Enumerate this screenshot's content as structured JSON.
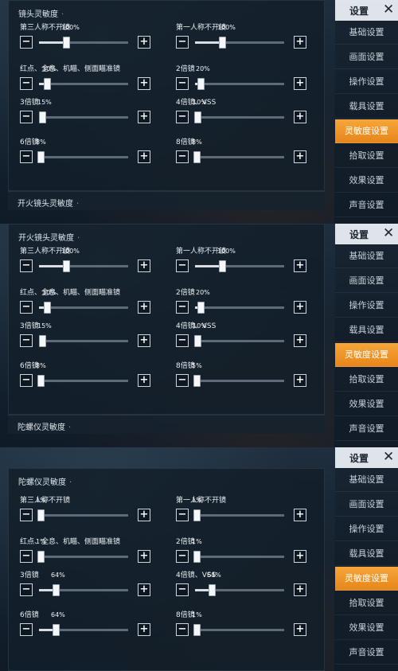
{
  "side_menu": {
    "title": "设置",
    "items": [
      "基础设置",
      "画面设置",
      "操作设置",
      "载具设置",
      "灵敏度设置",
      "拾取设置",
      "效果设置",
      "声音设置"
    ],
    "active": "灵敏度设置"
  },
  "screens": [
    {
      "section_title": "镜头灵敏度",
      "next_section": "开火镜头灵敏度",
      "controls": [
        {
          "label": "第三人称不开镜",
          "value": "100%",
          "level": 30
        },
        {
          "label": "第一人称不开镜",
          "value": "100%",
          "level": 30
        },
        {
          "label": "红点、全息、机瞄、侧面瞄准镜",
          "value": "30%",
          "level": 9
        },
        {
          "label": "2倍镜",
          "value": "20%",
          "level": 6
        },
        {
          "label": "3倍镜",
          "value": "15%",
          "level": 4
        },
        {
          "label": "4倍镜、VSS",
          "value": "10%",
          "level": 3
        },
        {
          "label": "6倍镜",
          "value": "8%",
          "level": 2
        },
        {
          "label": "8倍镜",
          "value": "8%",
          "level": 2
        }
      ]
    },
    {
      "section_title": "开火镜头灵敏度",
      "next_section": "陀螺仪灵敏度",
      "controls": [
        {
          "label": "第三人称不开镜",
          "value": "100%",
          "level": 30
        },
        {
          "label": "第一人称不开镜",
          "value": "100%",
          "level": 30
        },
        {
          "label": "红点、全息、机瞄、侧面瞄准镜",
          "value": "30%",
          "level": 9
        },
        {
          "label": "2倍镜",
          "value": "20%",
          "level": 6
        },
        {
          "label": "3倍镜",
          "value": "15%",
          "level": 4
        },
        {
          "label": "4倍镜、VSS",
          "value": "10%",
          "level": 3
        },
        {
          "label": "6倍镜",
          "value": "8%",
          "level": 2
        },
        {
          "label": "8倍镜",
          "value": "5%",
          "level": 1
        }
      ]
    },
    {
      "section_title": "陀螺仪灵敏度",
      "next_section": "",
      "controls": [
        {
          "label": "第三人称不开镜",
          "value": "1%",
          "level": 0
        },
        {
          "label": "第一人称不开镜",
          "value": "1%",
          "level": 0
        },
        {
          "label": "红点、全息、机瞄、侧面瞄准镜",
          "value": "1%",
          "level": 0
        },
        {
          "label": "2倍镜",
          "value": "1%",
          "level": 0
        },
        {
          "label": "3倍镜",
          "value": "64%",
          "level": 19
        },
        {
          "label": "4倍镜、VSS",
          "value": "64%",
          "level": 19
        },
        {
          "label": "6倍镜",
          "value": "64%",
          "level": 19
        },
        {
          "label": "8倍镜",
          "value": "1%",
          "level": 0
        }
      ]
    }
  ],
  "buttons": {
    "minus": "−",
    "plus": "+",
    "close": "✕"
  },
  "colors": {
    "accent": "#f0961f",
    "panel": "#121e2a"
  }
}
